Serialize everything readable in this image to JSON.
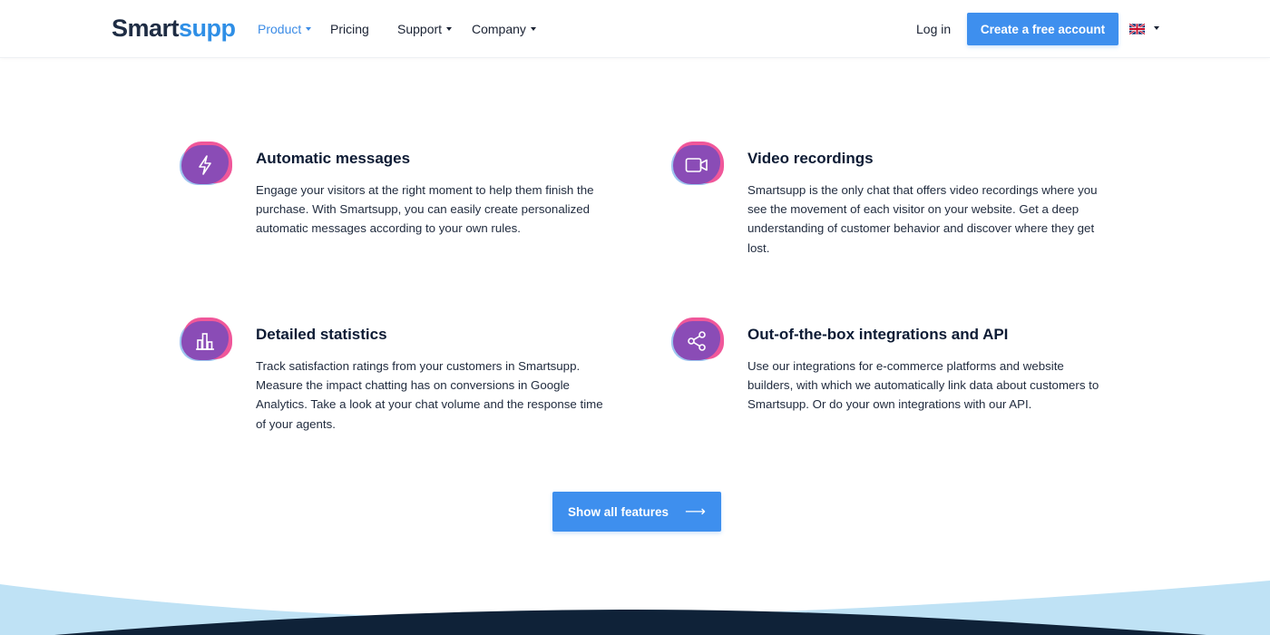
{
  "header": {
    "logo_part1": "Smart",
    "logo_part2": "supp",
    "nav": [
      {
        "label": "Product",
        "active": true,
        "dropdown": true
      },
      {
        "label": "Pricing",
        "active": false,
        "dropdown": false
      },
      {
        "label": "Support",
        "active": false,
        "dropdown": true
      },
      {
        "label": "Company",
        "active": false,
        "dropdown": true
      }
    ],
    "login": "Log in",
    "cta": "Create a free account",
    "language_icon": "uk-flag-icon"
  },
  "features": [
    {
      "title": "Automatic messages",
      "icon": "lightning-icon",
      "text": "Engage your visitors at the right moment to help them finish the purchase. With Smartsupp, you can easily create personalized automatic messages according to your own rules."
    },
    {
      "title": "Video recordings",
      "icon": "video-camera-icon",
      "text": "Smartsupp is the only chat that offers video recordings where you see the movement of each visitor on your website. Get a deep understanding of customer behavior and discover where they get lost."
    },
    {
      "title": "Detailed statistics",
      "icon": "bar-chart-icon",
      "text": "Track satisfaction ratings from your customers in Smartsupp. Measure the impact chatting has on conversions in Google Analytics. Take a look at your chat volume and the response time of your agents."
    },
    {
      "title": "Out-of-the-box integrations and API",
      "icon": "share-icon",
      "text": "Use our integrations for e-commerce platforms and website builders, with which we automatically link data about customers to Smartsupp. Or do your own integrations with our API."
    }
  ],
  "show_all": {
    "label": "Show all features",
    "arrow": "⟶"
  },
  "colors": {
    "accent": "#3e8fee",
    "icon_purple": "#8a4cb6",
    "icon_pink": "#f0579a",
    "icon_blue": "#9ec6ef",
    "footer_dark": "#0f2238",
    "footer_light": "#bfe2f5"
  }
}
